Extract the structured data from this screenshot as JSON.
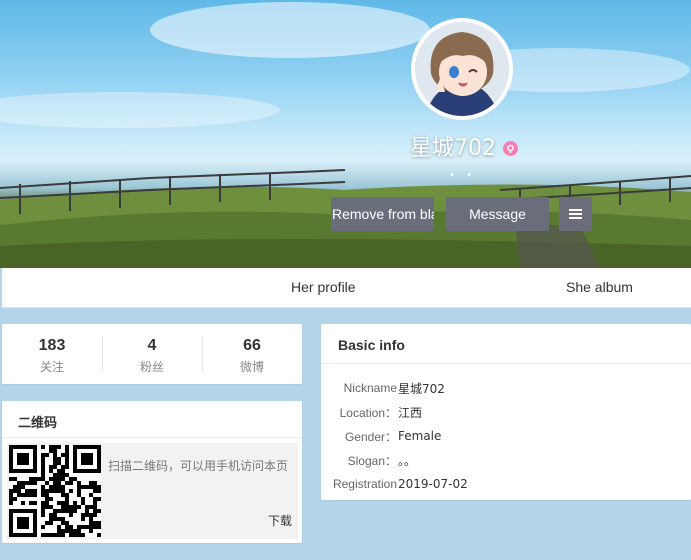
{
  "profile": {
    "nickname": "星城702",
    "dots": "• •"
  },
  "actions": {
    "remove_label": "Remove from blacklist",
    "message_label": "Message"
  },
  "tabs": [
    "Her profile",
    "She album"
  ],
  "counts": [
    {
      "value": "183",
      "label": "关注"
    },
    {
      "value": "4",
      "label": "粉丝"
    },
    {
      "value": "66",
      "label": "微博"
    }
  ],
  "qr": {
    "title": "二维码",
    "hint": "扫描二维码，可以用手机访问本页",
    "download": "下载"
  },
  "basic_info": {
    "title": "Basic info",
    "rows": [
      {
        "label": "Nickname",
        "value": "星城702"
      },
      {
        "label": "Location：",
        "value": "江西"
      },
      {
        "label": "Gender：",
        "value": "Female"
      },
      {
        "label": "Slogan：",
        "value": "。。"
      },
      {
        "label": "Registration",
        "value": "2019-07-02"
      }
    ]
  },
  "colors": {
    "button_bg": "#6a6e7a",
    "gender_badge": "#f57fb2",
    "page_bg": "#b4d4ea"
  }
}
